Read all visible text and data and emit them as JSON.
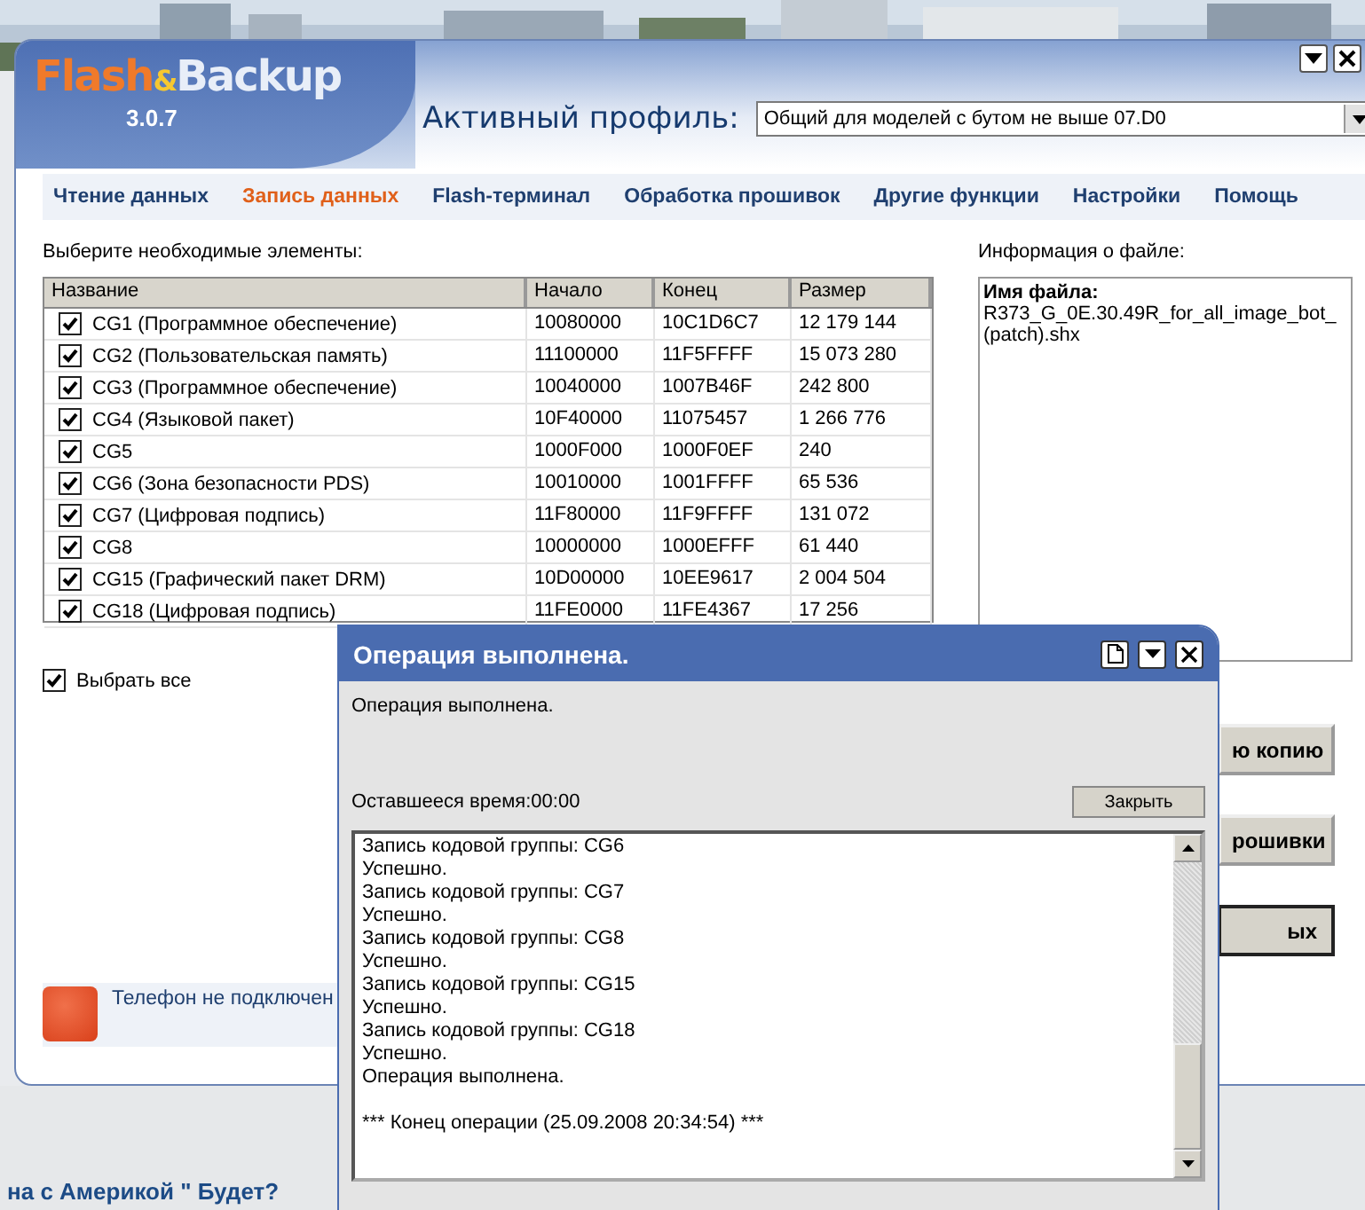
{
  "main_window": {
    "logo_left": "Flash",
    "logo_amp": "&",
    "logo_right": "Backup",
    "version": "3.0.7"
  },
  "profile": {
    "label": "Активный профиль:",
    "value": "Общий для моделей с бутом не выше 07.D0"
  },
  "tabs": [
    {
      "label": "Чтение данных",
      "selected": false
    },
    {
      "label": "Запись данных",
      "selected": true
    },
    {
      "label": "Flash-терминал",
      "selected": false
    },
    {
      "label": "Обработка прошивок",
      "selected": false
    },
    {
      "label": "Другие функции",
      "selected": false
    },
    {
      "label": "Настройки",
      "selected": false
    },
    {
      "label": "Помощь",
      "selected": false
    }
  ],
  "elements_label": "Выберите необходимые элементы:",
  "table": {
    "columns": [
      "Название",
      "Начало",
      "Конец",
      "Размер"
    ],
    "rows": [
      {
        "checked": true,
        "name": "CG1 (Программное обеспечение)",
        "start": "10080000",
        "end": "10C1D6C7",
        "size": "12 179 144"
      },
      {
        "checked": true,
        "name": "CG2 (Пользовательская память)",
        "start": "11100000",
        "end": "11F5FFFF",
        "size": "15 073 280"
      },
      {
        "checked": true,
        "name": "CG3 (Программное обеспечение)",
        "start": "10040000",
        "end": "1007B46F",
        "size": "242 800"
      },
      {
        "checked": true,
        "name": "CG4 (Языковой пакет)",
        "start": "10F40000",
        "end": "11075457",
        "size": "1 266 776"
      },
      {
        "checked": true,
        "name": "CG5",
        "start": "1000F000",
        "end": "1000F0EF",
        "size": "240"
      },
      {
        "checked": true,
        "name": "CG6 (Зона безопасности PDS)",
        "start": "10010000",
        "end": "1001FFFF",
        "size": "65 536"
      },
      {
        "checked": true,
        "name": "CG7 (Цифровая подпись)",
        "start": "11F80000",
        "end": "11F9FFFF",
        "size": "131 072"
      },
      {
        "checked": true,
        "name": "CG8",
        "start": "10000000",
        "end": "1000EFFF",
        "size": "61 440"
      },
      {
        "checked": true,
        "name": "CG15 (Графический пакет DRM)",
        "start": "10D00000",
        "end": "10EE9617",
        "size": "2 004 504"
      },
      {
        "checked": true,
        "name": "CG18 (Цифровая подпись)",
        "start": "11FE0000",
        "end": "11FE4367",
        "size": "17 256"
      }
    ]
  },
  "select_all": {
    "label": "Выбрать все",
    "checked": true
  },
  "file_info": {
    "label": "Информация о файле:",
    "name_label": "Имя файла:",
    "file_name": "R373_G_0E.30.49R_for_all_image_bot_(patch).shx"
  },
  "side_buttons": [
    {
      "label": "ю копию",
      "default": false
    },
    {
      "label": "рошивки",
      "default": false
    },
    {
      "label": "ых",
      "default": true
    }
  ],
  "status": {
    "text": "Телефон не подключен",
    "connected": false
  },
  "dialog": {
    "title": "Операция выполнена.",
    "message": "Операция выполнена.",
    "remaining_time": "Оставшееся время:00:00",
    "close_button": "Закрыть",
    "log": [
      "Запись кодовой группы: CG6",
      "Успешно.",
      "Запись кодовой группы: CG7",
      "Успешно.",
      "Запись кодовой группы: CG8",
      "Успешно.",
      "Запись кодовой группы: CG15",
      "Успешно.",
      "Запись кодовой группы: CG18",
      "Успешно.",
      "Операция выполнена."
    ],
    "log_footer": "*** Конец операции (25.09.2008 20:34:54) ***"
  },
  "background": {
    "bottom_text": "на с Америкой \" Будет?"
  }
}
